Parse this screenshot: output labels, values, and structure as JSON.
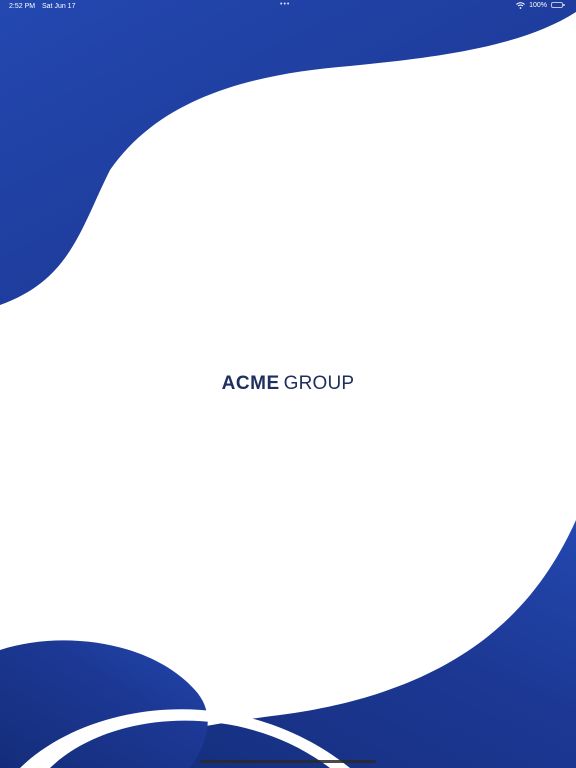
{
  "status_bar": {
    "time": "2:52 PM",
    "date": "Sat Jun 17",
    "multitask_dots": "•••",
    "battery": "100%",
    "wifi_icon": "wifi-icon",
    "battery_icon": "battery-icon"
  },
  "logo": {
    "strong": "ACME",
    "light": "GROUP"
  },
  "colors": {
    "brand_blue": "#1f3a96",
    "brand_blue_dark": "#142d7a",
    "logo_navy": "#1f2f5e",
    "background": "#ffffff"
  }
}
